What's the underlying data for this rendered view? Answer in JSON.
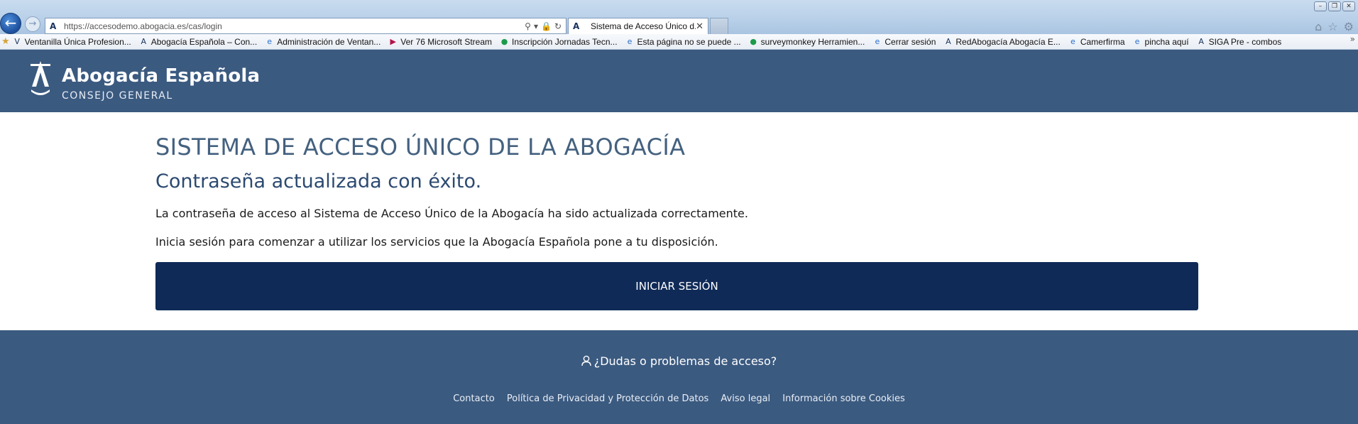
{
  "browser": {
    "url": "https://accesodemo.abogacia.es/cas/login",
    "tab_title": "Sistema de Acceso Único d...",
    "favorites": [
      {
        "label": "Ventanilla Única Profesion...",
        "icon": "V"
      },
      {
        "label": "Abogacía Española – Con...",
        "icon": "A"
      },
      {
        "label": "Administración de Ventan...",
        "icon": "e"
      },
      {
        "label": "Ver 76  Microsoft Stream",
        "icon": "▶"
      },
      {
        "label": "Inscripción Jornadas Tecn...",
        "icon": "●"
      },
      {
        "label": "Esta página no se puede ...",
        "icon": "e"
      },
      {
        "label": "surveymonkey Herramien...",
        "icon": "●"
      },
      {
        "label": "Cerrar sesión",
        "icon": "e"
      },
      {
        "label": "RedAbogacía  Abogacía E...",
        "icon": "A"
      },
      {
        "label": "Camerfirma",
        "icon": "e"
      },
      {
        "label": "pincha aquí",
        "icon": "e"
      },
      {
        "label": "SIGA Pre - combos",
        "icon": "A"
      }
    ]
  },
  "header": {
    "brand": "Abogacía Española",
    "sub": "CONSEJO GENERAL"
  },
  "main": {
    "title": "SISTEMA DE ACCESO ÚNICO DE LA ABOGACÍA",
    "subtitle": "Contraseña actualizada con éxito.",
    "message1": "La contraseña de acceso al Sistema de Acceso Único de la Abogacía ha sido actualizada correctamente.",
    "message2": "Inicia sesión para comenzar a utilizar los servicios que la Abogacía Española pone a tu disposición.",
    "login_label": "INICIAR SESIÓN"
  },
  "footer": {
    "help": "¿Dudas o problemas de acceso?",
    "links": [
      "Contacto",
      "Política de Privacidad y Protección de Datos",
      "Aviso legal",
      "Información sobre Cookies"
    ]
  },
  "colors": {
    "header_bg": "#3b5a80",
    "button_bg": "#0f2a57",
    "title": "#44617f"
  }
}
